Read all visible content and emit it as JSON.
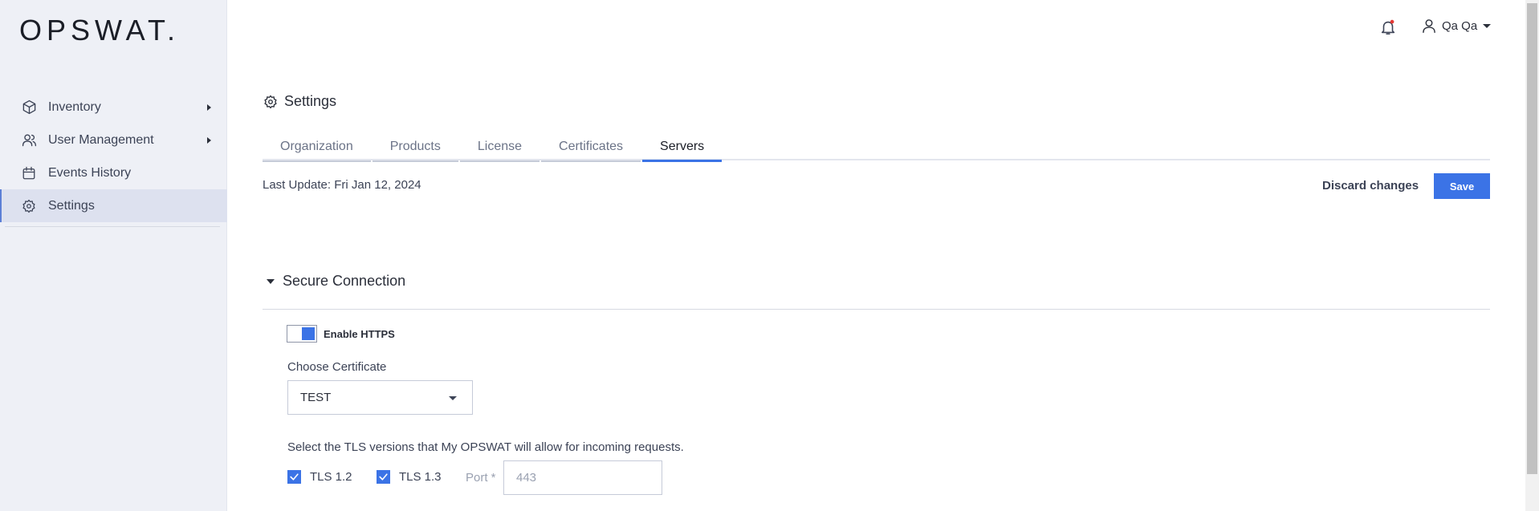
{
  "app": {
    "logo_text": "OPSWAT",
    "logo_dot": "."
  },
  "sidebar": {
    "items": [
      {
        "label": "Inventory",
        "icon": "cube-icon",
        "has_submenu": true,
        "active": false
      },
      {
        "label": "User Management",
        "icon": "users-icon",
        "has_submenu": true,
        "active": false
      },
      {
        "label": "Events History",
        "icon": "calendar-icon",
        "has_submenu": false,
        "active": false
      },
      {
        "label": "Settings",
        "icon": "gear-icon",
        "has_submenu": false,
        "active": true
      }
    ]
  },
  "header": {
    "notification_icon": "bell-icon",
    "notification_badge_color": "#e53935",
    "user_name": "Qa Qa"
  },
  "page": {
    "title": "Settings",
    "tabs": [
      {
        "label": "Organization",
        "active": false
      },
      {
        "label": "Products",
        "active": false
      },
      {
        "label": "License",
        "active": false
      },
      {
        "label": "Certificates",
        "active": false
      },
      {
        "label": "Servers",
        "active": true
      }
    ],
    "last_update": "Last Update: Fri Jan 12, 2024",
    "discard_label": "Discard changes",
    "save_label": "Save"
  },
  "secure_connection": {
    "title": "Secure Connection",
    "expanded": true,
    "https_label": "Enable HTTPS",
    "https_enabled": true,
    "certificate_label": "Choose Certificate",
    "certificate_value": "TEST",
    "tls_description": "Select the TLS versions that My OPSWAT will allow for incoming requests.",
    "tls_options": [
      {
        "label": "TLS 1.2",
        "checked": true
      },
      {
        "label": "TLS 1.3",
        "checked": true
      }
    ],
    "port_label": "Port *",
    "port_placeholder": "443"
  },
  "colors": {
    "accent": "#3b73e6",
    "sidebar_bg": "#eef0f6",
    "sidebar_active_bg": "#dde1ef"
  }
}
